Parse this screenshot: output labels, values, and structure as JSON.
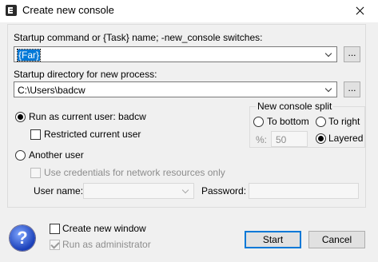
{
  "window": {
    "title": "Create new console",
    "icon": "app-console-icon"
  },
  "startup_command": {
    "label": "Startup command or {Task} name; -new_console switches:",
    "value": "{Far}",
    "browse_label": "..."
  },
  "startup_directory": {
    "label": "Startup directory for new process:",
    "value": "C:\\Users\\badcw",
    "browse_label": "..."
  },
  "run_as_current": {
    "label": "Run as current user: badcw",
    "checked": true
  },
  "restricted": {
    "label": "Restricted current user",
    "checked": false
  },
  "another_user": {
    "label": "Another user",
    "checked": false
  },
  "use_credentials": {
    "label": "Use credentials for network resources only",
    "checked": false
  },
  "user_name": {
    "label": "User name:",
    "value": ""
  },
  "password": {
    "label": "Password:",
    "value": ""
  },
  "split": {
    "title": "New console split",
    "to_bottom": "To bottom",
    "to_right": "To right",
    "percent_label": "%:",
    "percent_value": "50",
    "layered": "Layered",
    "selected": "Layered"
  },
  "create_new_window": {
    "label": "Create new window",
    "checked": false
  },
  "run_as_admin": {
    "label": "Run as administrator",
    "checked": true
  },
  "buttons": {
    "start": "Start",
    "cancel": "Cancel"
  },
  "help": {
    "glyph": "?",
    "icon": "help-icon"
  },
  "colors": {
    "accent": "#0078d7",
    "background": "#f0f0f0"
  }
}
